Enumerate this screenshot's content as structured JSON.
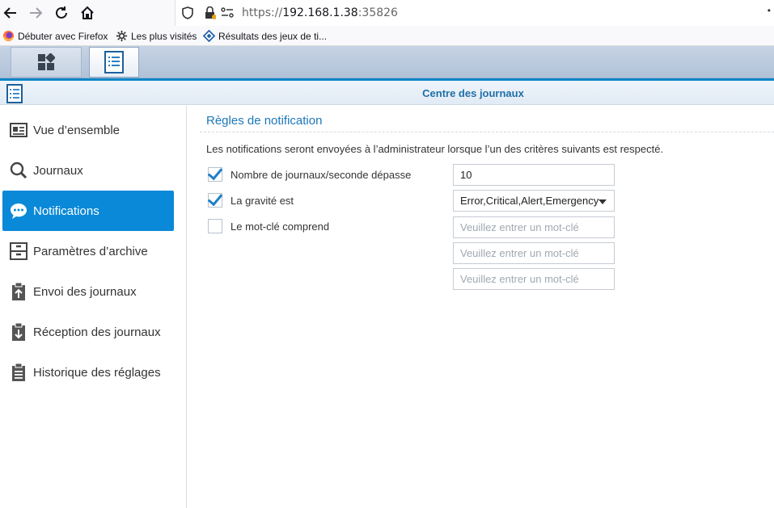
{
  "browser": {
    "url_prefix": "https://",
    "url_host": "192.168.1.38",
    "url_port": ":35826",
    "bookmarks": [
      {
        "label": "Débuter avec Firefox",
        "icon": "firefox-icon"
      },
      {
        "label": "Les plus visités",
        "icon": "gear-icon"
      },
      {
        "label": "Résultats des jeux de ti...",
        "icon": "diamond-icon"
      }
    ]
  },
  "app": {
    "title": "Centre des journaux"
  },
  "sidebar": {
    "items": [
      {
        "label": "Vue d’ensemble",
        "icon": "overview-card-icon"
      },
      {
        "label": "Journaux",
        "icon": "search-icon"
      },
      {
        "label": "Notifications",
        "icon": "chat-bubble-icon"
      },
      {
        "label": "Paramètres d’archive",
        "icon": "archive-drawer-icon"
      },
      {
        "label": "Envoi des journaux",
        "icon": "clipboard-upload-icon"
      },
      {
        "label": "Réception des journaux",
        "icon": "clipboard-download-icon"
      },
      {
        "label": "Historique des réglages",
        "icon": "clipboard-list-icon"
      }
    ],
    "active_index": 2
  },
  "main": {
    "section_title": "Règles de notification",
    "description": "Les notifications seront envoyées à l’administrateur lorsque l’un des critères suivants est respecté.",
    "rules": [
      {
        "label": "Nombre de journaux/seconde dépasse",
        "checked": true,
        "value": "10"
      },
      {
        "label": "La gravité est",
        "checked": true,
        "value": "Error,Critical,Alert,Emergency"
      },
      {
        "label": "Le mot-clé comprend",
        "checked": false
      }
    ],
    "keyword_placeholder": "Veuillez entrer un mot-clé"
  },
  "colors": {
    "accent": "#0a89d8",
    "title_blue": "#1d77b8"
  }
}
